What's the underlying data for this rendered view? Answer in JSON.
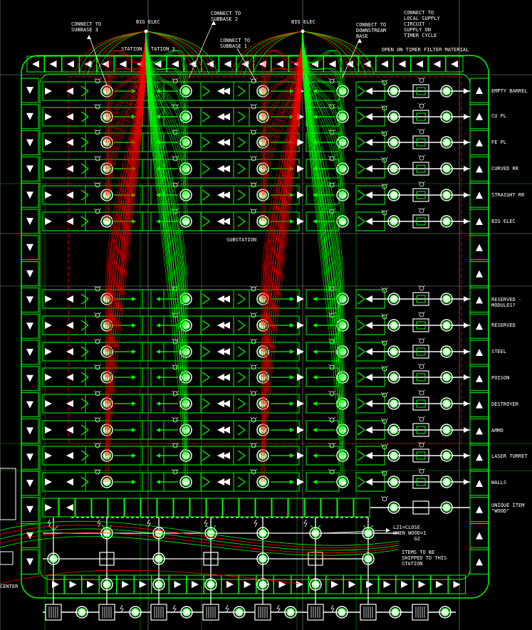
{
  "header_labels": {
    "connect_subbase3": "CONNECT TO\nSUBBASE 3",
    "big_elec_1": "BIG ELEC",
    "connect_subbase2": "CONNECT TO\nSUBBASE 2",
    "connect_subbase1": "CONNECT TO\nSUBBASE 1",
    "big_elec_2": "BIG ELEC",
    "connect_downstream": "CONNECT TO\nDOWNSTREAM\nBASE",
    "connect_local": "CONNECT TO\nLOCAL SUPPLY\nCIRCUIT -\nSUPPLY ON\nTIMER CYCLE",
    "station_3a": "STATION",
    "station_3b": "TATION 3",
    "open_on_timer": "OPEN ON TIMER",
    "filter_material": "FILTER MATERIAL"
  },
  "substation_label": "SUBSTATION",
  "row_labels": [
    "EMPTY BARREL",
    "CU PL",
    "FE PL",
    "CURVED RR",
    "STRAIGHT RR",
    "BIG ELEC",
    "RESERVED -\nMODULES?",
    "RESERVED",
    "STEEL",
    "POISON",
    "DESTROYER",
    "AMMO",
    "LASER TURRET",
    "WALLS",
    "UNIQUE ITEM\n\"WOOD\""
  ],
  "bottom_labels": {
    "close_note": "L21=CLOSE\nWHEN WOOD=1\n       G2",
    "shipped_note": "ITEMS TO BE\nSHIPPED TO THIS\nSTATION",
    "center": "CENTER"
  },
  "colors": {
    "green": "#00ff00",
    "red": "#ff0000",
    "white": "#ffffff",
    "grid_white": "#ffffff",
    "grid_green": "#00c000",
    "background": "#000000"
  }
}
